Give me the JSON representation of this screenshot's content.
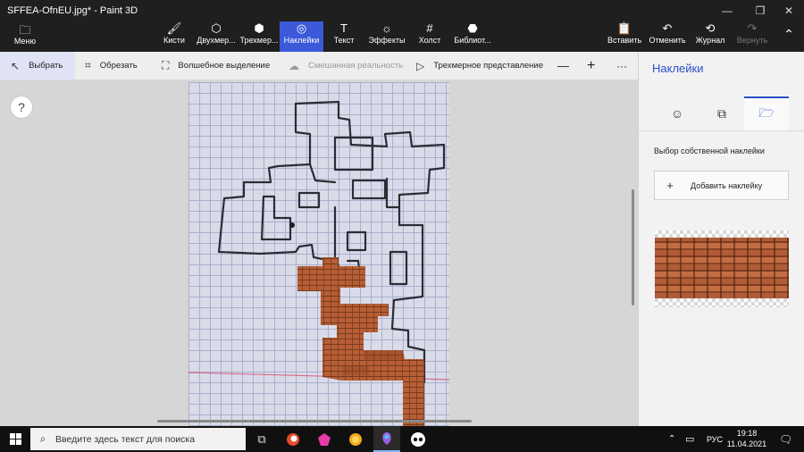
{
  "window": {
    "title": "SFFEA-OfnEU.jpg* - Paint 3D",
    "minimize": "—",
    "maximize": "❐",
    "close": "✕"
  },
  "menu": {
    "label": "Меню",
    "icon": "folder-icon"
  },
  "ribbon_tools": [
    {
      "label": "Кисти",
      "icon": "brush-icon"
    },
    {
      "label": "Двухмер...",
      "icon": "2d-shapes-icon"
    },
    {
      "label": "Трехмер...",
      "icon": "3d-shapes-icon"
    },
    {
      "label": "Наклейки",
      "icon": "stickers-icon",
      "active": true
    },
    {
      "label": "Текст",
      "icon": "text-icon"
    },
    {
      "label": "Эффекты",
      "icon": "effects-icon"
    },
    {
      "label": "Холст",
      "icon": "canvas-icon"
    },
    {
      "label": "Библиот...",
      "icon": "library-icon"
    }
  ],
  "ribbon_right": {
    "paste": "Вставить",
    "undo": "Отменить",
    "history": "Журнал",
    "redo": "Вернуть"
  },
  "toolbar": {
    "select": "Выбрать",
    "crop": "Обрезать",
    "magic_select": "Волшебное выделение",
    "mixed_reality": "Смешанная реальность",
    "view_3d": "Трехмерное представление",
    "zoom_out": "—",
    "zoom_in": "+",
    "more": "···"
  },
  "canvas": {
    "help": "?"
  },
  "panel": {
    "title": "Наклейки",
    "tabs": [
      {
        "icon": "sticker-smiley-icon"
      },
      {
        "icon": "texture-icon"
      },
      {
        "icon": "custom-sticker-folder-icon",
        "active": true
      }
    ],
    "custom_label": "Выбор собственной наклейки",
    "add_sticker": "Добавить наклейку"
  },
  "taskbar": {
    "search_placeholder": "Введите здесь текст для поиска",
    "language": "РУС",
    "time": "19:18",
    "date": "11.04.2021"
  },
  "colors": {
    "accent": "#3b59d9",
    "panel_accent": "#2a4fc7",
    "brick": "#b65e35"
  }
}
